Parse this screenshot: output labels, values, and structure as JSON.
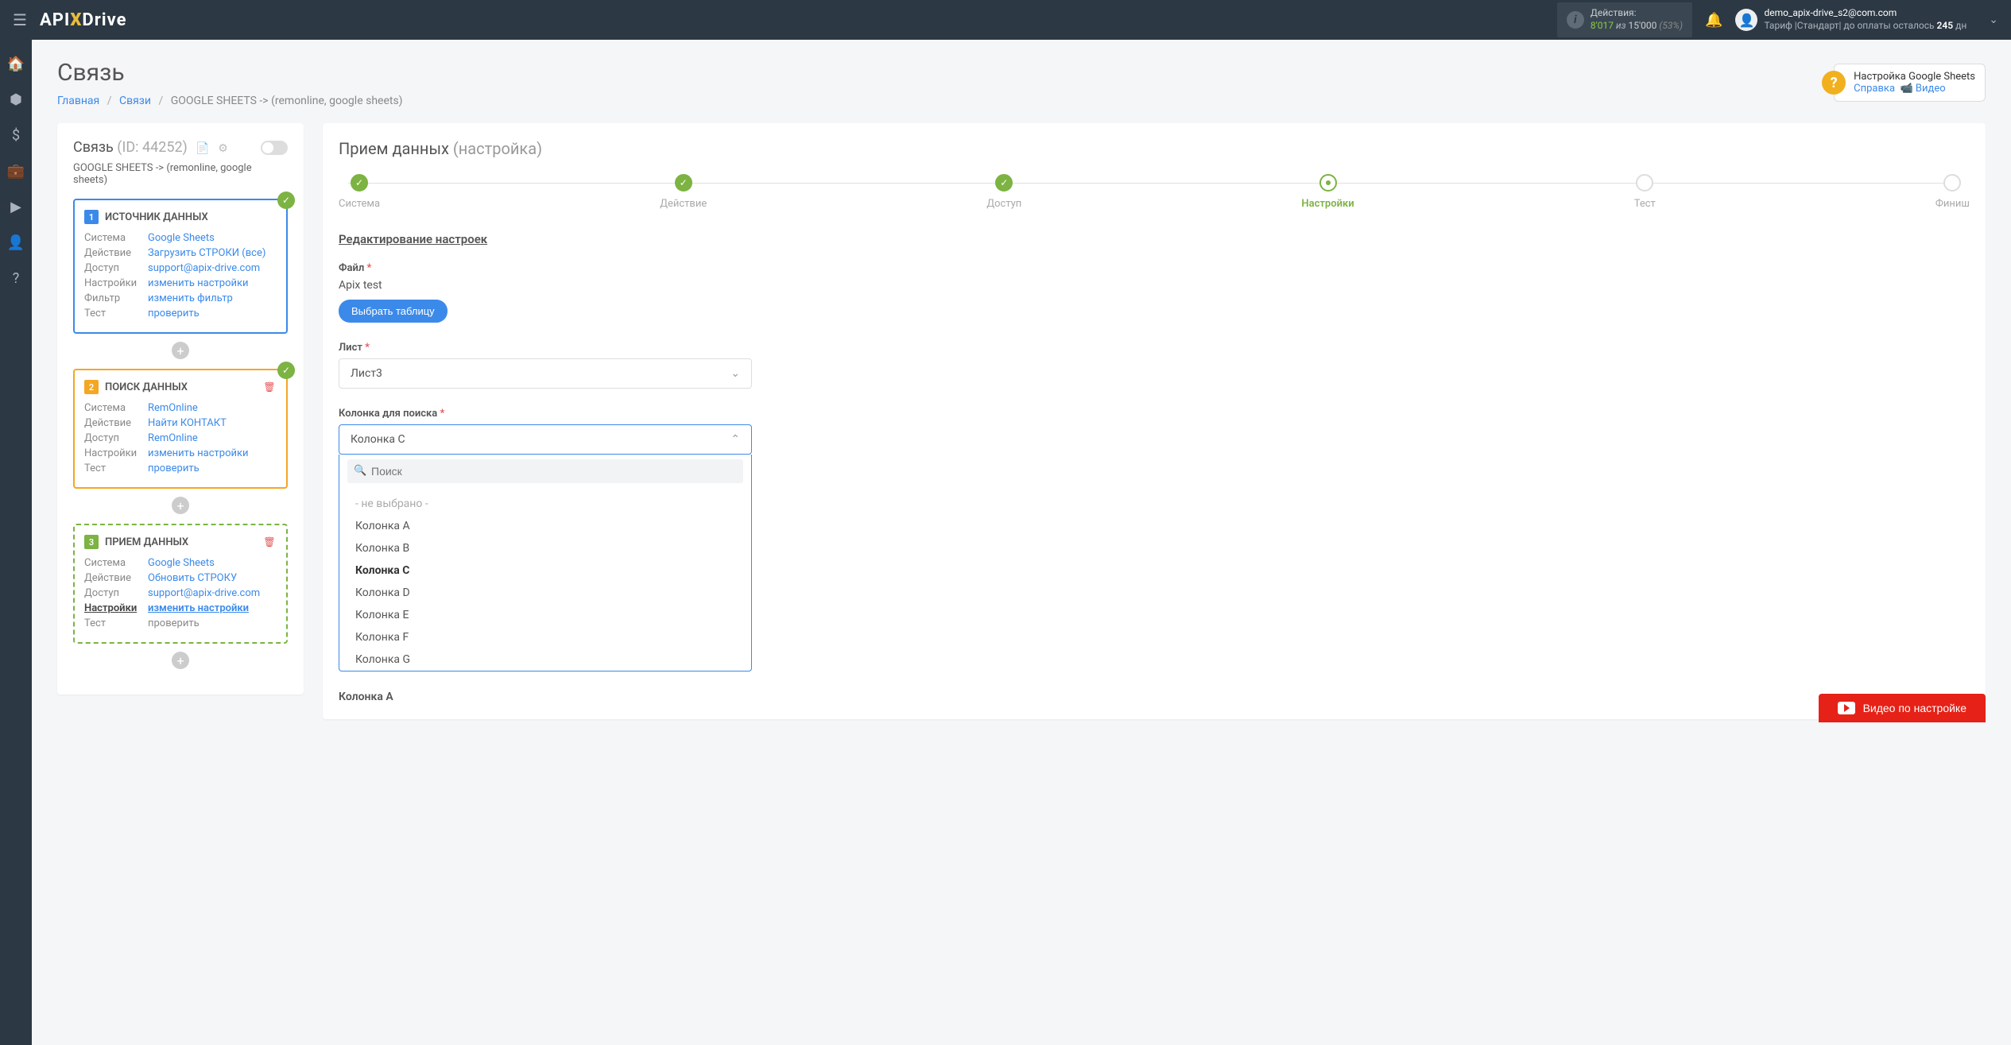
{
  "header": {
    "logo_pre": "API",
    "logo_x": "X",
    "logo_post": "Drive",
    "actions_label": "Действия:",
    "actions_current": "8'017",
    "actions_of": "из",
    "actions_total": "15'000",
    "actions_pct": "(53%)",
    "user_email": "demo_apix-drive_s2@com.com",
    "plan_prefix": "Тариф |Стандарт| до оплаты осталось ",
    "days": "245",
    "days_suffix": " дн"
  },
  "page": {
    "title": "Связь",
    "breadcrumb_home": "Главная",
    "breadcrumb_links": "Связи",
    "breadcrumb_current": "GOOGLE SHEETS -> (remonline, google sheets)"
  },
  "help": {
    "title": "Настройка Google Sheets",
    "link1": "Справка",
    "link2": "Видео"
  },
  "leftPanel": {
    "title": "Связь",
    "id_label": "(ID: 44252)",
    "sub": "GOOGLE SHEETS -> (remonline, google sheets)",
    "blocks": [
      {
        "num": "1",
        "title": "ИСТОЧНИК ДАННЫХ",
        "color": "blue",
        "check": true,
        "rows": [
          {
            "label": "Система",
            "value": "Google Sheets"
          },
          {
            "label": "Действие",
            "value": "Загрузить СТРОКИ (все)"
          },
          {
            "label": "Доступ",
            "value": "support@apix-drive.com"
          },
          {
            "label": "Настройки",
            "value": "изменить настройки"
          },
          {
            "label": "Фильтр",
            "value": "изменить фильтр"
          },
          {
            "label": "Тест",
            "value": "проверить"
          }
        ]
      },
      {
        "num": "2",
        "title": "ПОИСК ДАННЫХ",
        "color": "orange",
        "check": true,
        "trash": true,
        "rows": [
          {
            "label": "Система",
            "value": "RemOnline"
          },
          {
            "label": "Действие",
            "value": "Найти КОНТАКТ"
          },
          {
            "label": "Доступ",
            "value": "RemOnline"
          },
          {
            "label": "Настройки",
            "value": "изменить настройки"
          },
          {
            "label": "Тест",
            "value": "проверить"
          }
        ]
      },
      {
        "num": "3",
        "title": "ПРИЕМ ДАННЫХ",
        "color": "green",
        "trash": true,
        "rows": [
          {
            "label": "Система",
            "value": "Google Sheets"
          },
          {
            "label": "Действие",
            "value": "Обновить СТРОКУ"
          },
          {
            "label": "Доступ",
            "value": "support@apix-drive.com"
          },
          {
            "label": "Настройки",
            "value": "изменить настройки",
            "active": true
          },
          {
            "label": "Тест",
            "value": "проверить",
            "gray": true
          }
        ]
      }
    ]
  },
  "rightPanel": {
    "title": "Прием данных",
    "subtitle": "(настройка)",
    "steps": [
      "Система",
      "Действие",
      "Доступ",
      "Настройки",
      "Тест",
      "Финиш"
    ],
    "section": "Редактирование настроек",
    "file_label": "Файл",
    "file_value": "Apix test",
    "btn_choose": "Выбрать таблицу",
    "sheet_label": "Лист",
    "sheet_value": "Лист3",
    "search_col_label": "Колонка для поиска",
    "search_col_value": "Колонка C",
    "search_placeholder": "Поиск",
    "options_placeholder": "- не выбрано -",
    "options": [
      "Колонка A",
      "Колонка B",
      "Колонка C",
      "Колонка D",
      "Колонка E",
      "Колонка F",
      "Колонка G"
    ],
    "selected_option": "Колонка C",
    "col_a_label": "Колонка А",
    "video_btn": "Видео по настройке"
  }
}
